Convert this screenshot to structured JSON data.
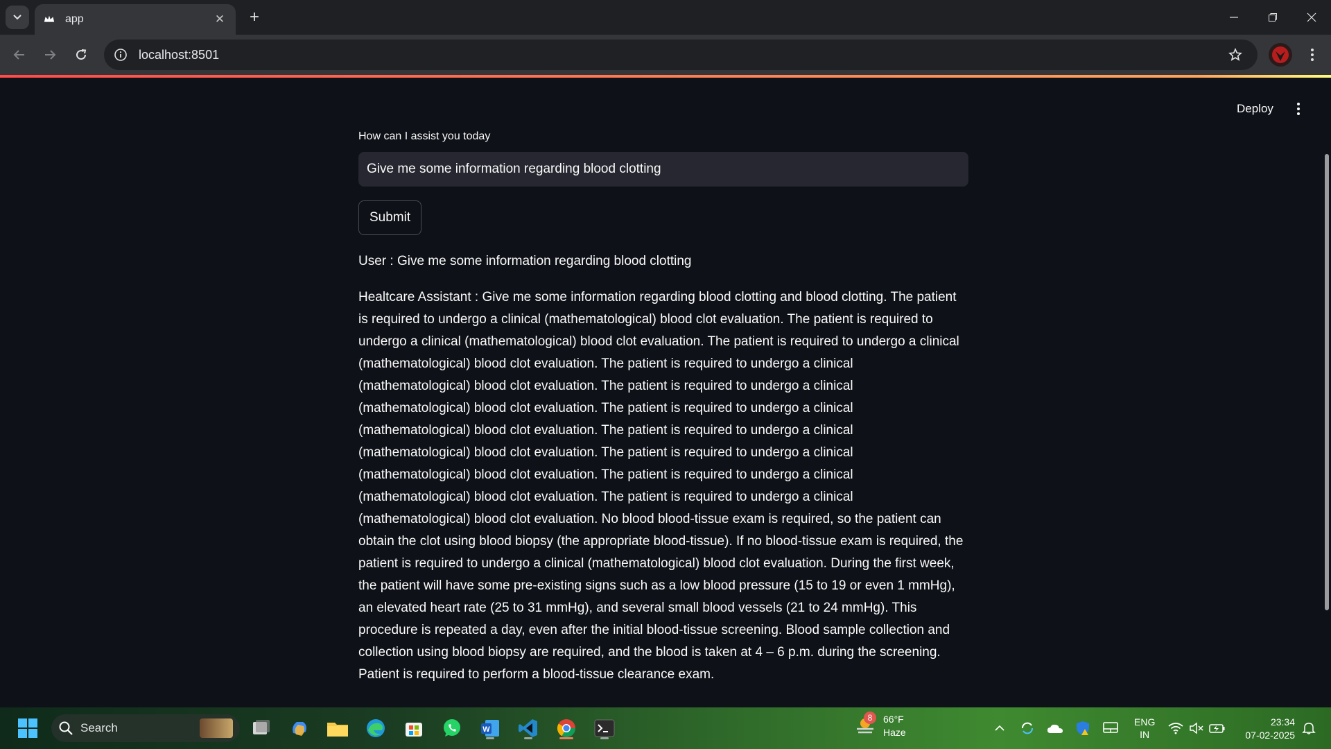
{
  "browser": {
    "tab_title": "app",
    "url": "localhost:8501"
  },
  "app": {
    "deploy_label": "Deploy",
    "input_label": "How can I assist you today",
    "input_value": "Give me some information regarding blood clotting",
    "submit_label": "Submit",
    "user_message": "User : Give me some information regarding blood clotting",
    "assistant_message": "Healtcare Assistant : Give me some information regarding blood clotting and blood clotting. The patient is required to undergo a clinical (mathematological) blood clot evaluation. The patient is required to undergo a clinical (mathematological) blood clot evaluation. The patient is required to undergo a clinical (mathematological) blood clot evaluation. The patient is required to undergo a clinical (mathematological) blood clot evaluation. The patient is required to undergo a clinical (mathematological) blood clot evaluation. The patient is required to undergo a clinical (mathematological) blood clot evaluation. The patient is required to undergo a clinical (mathematological) blood clot evaluation. The patient is required to undergo a clinical (mathematological) blood clot evaluation. The patient is required to undergo a clinical (mathematological) blood clot evaluation. The patient is required to undergo a clinical (mathematological) blood clot evaluation. No blood blood-tissue exam is required, so the patient can obtain the clot using blood biopsy (the appropriate blood-tissue). If no blood-tissue exam is required, the patient is required to undergo a clinical (mathematological) blood clot evaluation. During the first week, the patient will have some pre-existing signs such as a low blood pressure (15 to 19 or even 1 mmHg), an elevated heart rate (25 to 31 mmHg), and several small blood vessels (21 to 24 mmHg). This procedure is repeated a day, even after the initial blood-tissue screening. Blood sample collection and collection using blood biopsy are required, and the blood is taken at 4 – 6 p.m. during the screening. Patient is required to perform a blood-tissue clearance exam."
  },
  "taskbar": {
    "search_label": "Search",
    "weather_badge": "8",
    "weather_temp": "66°F",
    "weather_cond": "Haze",
    "lang_line1": "ENG",
    "lang_line2": "IN",
    "time": "23:34",
    "date": "07-02-2025"
  },
  "colors": {
    "page_bg": "#0e1117",
    "input_bg": "#262730",
    "accent": "#ff4b4b"
  }
}
